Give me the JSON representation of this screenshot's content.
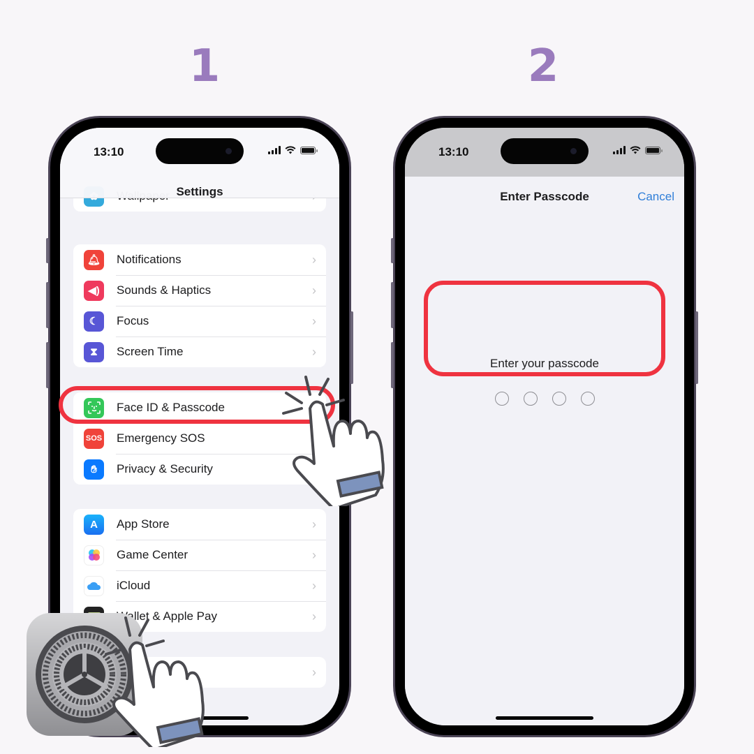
{
  "steps": [
    "1",
    "2"
  ],
  "colors": {
    "step_number": "#9a7bbd",
    "highlight": "#ef3340",
    "link": "#2f7ed8",
    "hand_cuff": "#7d93bd"
  },
  "status_bar": {
    "time": "13:10",
    "signal_icon": "cellular-signal-icon",
    "wifi_icon": "wifi-icon",
    "battery_icon": "battery-icon"
  },
  "screen1": {
    "title": "Settings",
    "groups": [
      {
        "items": [
          {
            "label": "Wallpaper",
            "icon": "wallpaper-icon",
            "color": "#34aadc"
          }
        ]
      },
      {
        "items": [
          {
            "label": "Notifications",
            "icon": "bell-icon",
            "color": "#f0433a"
          },
          {
            "label": "Sounds & Haptics",
            "icon": "speaker-icon",
            "color": "#ef3a5d"
          },
          {
            "label": "Focus",
            "icon": "moon-icon",
            "color": "#5856d6"
          },
          {
            "label": "Screen Time",
            "icon": "hourglass-icon",
            "color": "#5856d6"
          }
        ]
      },
      {
        "items": [
          {
            "label": "Face ID & Passcode",
            "icon": "face-id-icon",
            "color": "#34c759"
          },
          {
            "label": "Emergency SOS",
            "icon": "sos-icon",
            "color": "#f0433a",
            "icon_text": "SOS"
          },
          {
            "label": "Privacy & Security",
            "icon": "hand-icon",
            "color": "#0a7aff"
          }
        ]
      },
      {
        "items": [
          {
            "label": "App Store",
            "icon": "app-store-icon",
            "color": "#1c8ef9"
          },
          {
            "label": "Game Center",
            "icon": "game-center-icon",
            "color": "#ffffff"
          },
          {
            "label": "iCloud",
            "icon": "cloud-icon",
            "color": "#ffffff"
          },
          {
            "label": "Wallet & Apple Pay",
            "icon": "wallet-icon",
            "color": "#222222"
          }
        ]
      },
      {
        "items": [
          {
            "label": "",
            "icon": "",
            "color": ""
          }
        ]
      }
    ]
  },
  "screen2": {
    "title": "Enter Passcode",
    "cancel_label": "Cancel",
    "prompt": "Enter your passcode",
    "passcode_length": 4,
    "digits_entered": 0
  }
}
